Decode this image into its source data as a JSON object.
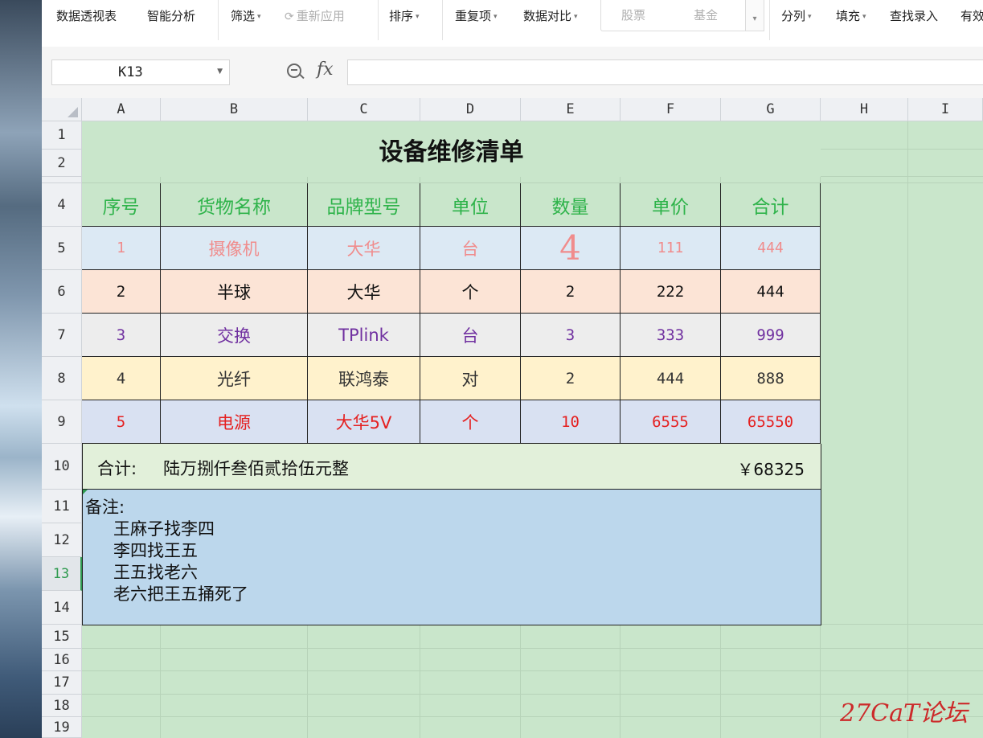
{
  "ribbon": {
    "items": [
      {
        "label": "数据透视表",
        "caret": false
      },
      {
        "label": "智能分析",
        "caret": false
      },
      {
        "label": "筛选",
        "caret": true
      },
      {
        "label": "重新应用",
        "caret": false,
        "disabled": true
      },
      {
        "label": "排序",
        "caret": true
      },
      {
        "label": "重复项",
        "caret": true
      },
      {
        "label": "数据对比",
        "caret": true
      },
      {
        "label": "分列",
        "caret": true
      },
      {
        "label": "填充",
        "caret": true
      },
      {
        "label": "查找录入",
        "caret": false
      },
      {
        "label": "有效",
        "caret": false
      }
    ],
    "stock_label": "股票",
    "fund_label": "基金"
  },
  "formula_bar": {
    "name_box": "K13",
    "fx_label": "fx",
    "formula": ""
  },
  "columns": [
    "A",
    "B",
    "C",
    "D",
    "E",
    "F",
    "G",
    "H",
    "I"
  ],
  "rows": [
    "1",
    "2",
    "4",
    "5",
    "6",
    "7",
    "8",
    "9",
    "10",
    "11",
    "12",
    "13",
    "14",
    "15",
    "16",
    "17",
    "18",
    "19"
  ],
  "active_row": "13",
  "sheet": {
    "title": "设备维修清单",
    "headers": [
      "序号",
      "货物名称",
      "品牌型号",
      "单位",
      "数量",
      "单价",
      "合计"
    ],
    "data_rows": [
      {
        "cells": [
          "1",
          "摄像机",
          "大华",
          "台",
          "4",
          "111",
          "444"
        ],
        "bg": "#dce9f4",
        "color": "#f08c8c"
      },
      {
        "cells": [
          "2",
          "半球",
          "大华",
          "个",
          "2",
          "222",
          "444"
        ],
        "bg": "#fce4d6",
        "color": "#111111"
      },
      {
        "cells": [
          "3",
          "交换",
          "TPlink",
          "台",
          "3",
          "333",
          "999"
        ],
        "bg": "#ededed",
        "color": "#7030a0"
      },
      {
        "cells": [
          "4",
          "光纤",
          "联鸿泰",
          "对",
          "2",
          "444",
          "888"
        ],
        "bg": "#fff2cc",
        "color": "#333333"
      },
      {
        "cells": [
          "5",
          "电源",
          "大华5V",
          "个",
          "10",
          "6555",
          "65550"
        ],
        "bg": "#d9e1f2",
        "color": "#e52020"
      }
    ],
    "header_color": "#2eb34a",
    "total_label": "合计:",
    "total_words": "陆万捌仟叁佰贰拾伍元整",
    "total_amount": "￥68325",
    "notes": {
      "label": "备注:",
      "lines": [
        "王麻子找李四",
        "李四找王五",
        "王五找老六",
        "老六把王五捅死了"
      ]
    }
  },
  "watermark": "27CaT论坛"
}
